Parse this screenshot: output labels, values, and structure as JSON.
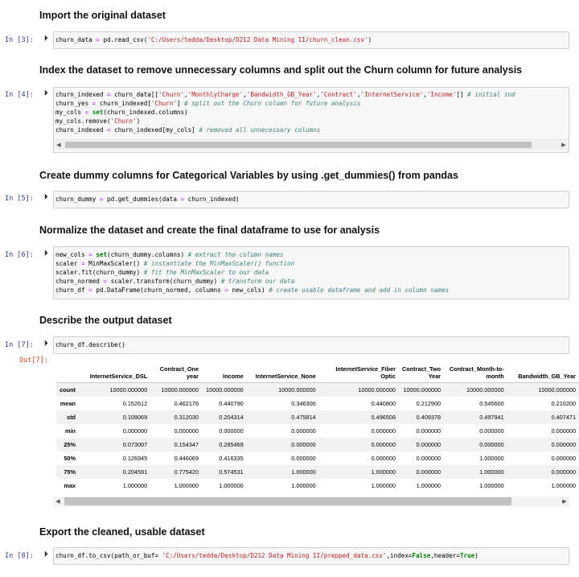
{
  "cells": [
    {
      "heading": "Import the original dataset",
      "prompt": "In [3]:"
    },
    {
      "heading": "Index the dataset to remove unnecessary columns and split out the Churn column for future analysis",
      "prompt": "In [4]:"
    },
    {
      "heading": "Create dummy columns for Categorical Variables by using .get_dummies() from pandas",
      "prompt": "In [5]:"
    },
    {
      "heading": "Normalize the dataset and create the final dataframe to use for analysis",
      "prompt": "In [6]:"
    },
    {
      "heading": "Describe the output dataset",
      "prompt": "In [7]:",
      "out_prompt": "Out[7]:"
    },
    {
      "heading": "Export the cleaned, usable dataset",
      "prompt": "In [8]:"
    }
  ],
  "run_icon": "step-forward-icon",
  "code": {
    "c3": "churn_data = pd.read_csv('C:/Users/tedda/Desktop/D212 Data Mining II/churn_clean.csv')",
    "c4": [
      "churn_indexed = churn_data[['Churn','MonthlyCharge','Bandwidth_GB_Year','Contract','InternetService','Income']] # initial ind",
      "churn_yes = churn_indexed['Churn'] # split out the Churn column for future analysis",
      "my_cols = set(churn_indexed.columns)",
      "my_cols.remove('Churn')",
      "churn_indexed = churn_indexed[my_cols] # removed all unnecessary columns"
    ],
    "c5": "churn_dummy = pd.get_dummies(data = churn_indexed)",
    "c6": [
      "new_cols = set(churn_dummy.columns) # extract the column names",
      "scaler = MinMaxScaler() # instantiate the MinMaxScaler() function",
      "scaler.fit(churn_dummy) # fit the MinMaxScaler to our data",
      "churn_normed = scaler.transform(churn_dummy) # transform our data",
      "churn_df = pd.DataFrame(churn_normed, columns = new_cols) # create usable dataframe and add in column names"
    ],
    "c7": "churn_df.describe()",
    "c8": "churn_df.to_csv(path_or_buf= 'C:/Users/tedda/Desktop/D212 Data Mining II/prepped_data.csv',index=False,header=True)"
  },
  "table": {
    "columns": [
      "InternetService_DSL",
      "Contract_One year",
      "Income",
      "InternetService_None",
      "InternetService_Fiber Optic",
      "Contract_Two Year",
      "Contract_Month-to-month",
      "Bandwidth_GB_Year"
    ],
    "rows": [
      {
        "label": "count",
        "values": [
          "10000.000000",
          "10000.000000",
          "10000.000000",
          "10000.000000",
          "10000.000000",
          "10000.000000",
          "10000.000000",
          "10000.000000"
        ]
      },
      {
        "label": "mean",
        "values": [
          "0.152612",
          "0.462176",
          "0.440790",
          "0.346300",
          "0.440800",
          "0.212900",
          "0.545600",
          "0.210200"
        ]
      },
      {
        "label": "std",
        "values": [
          "0.109069",
          "0.312030",
          "0.204314",
          "0.475814",
          "0.496508",
          "0.409378",
          "0.497941",
          "0.407471"
        ]
      },
      {
        "label": "min",
        "values": [
          "0.000000",
          "0.000000",
          "0.000000",
          "0.000000",
          "0.000000",
          "0.000000",
          "0.000000",
          "0.000000"
        ]
      },
      {
        "label": "25%",
        "values": [
          "0.073007",
          "0.154347",
          "0.285469",
          "0.000000",
          "0.000000",
          "0.000000",
          "0.000000",
          "0.000000"
        ]
      },
      {
        "label": "50%",
        "values": [
          "0.126945",
          "0.446069",
          "0.416335",
          "0.000000",
          "0.000000",
          "0.000000",
          "1.000000",
          "0.000000"
        ]
      },
      {
        "label": "75%",
        "values": [
          "0.204591",
          "0.775420",
          "0.574531",
          "1.000000",
          "1.000000",
          "0.000000",
          "1.000000",
          "0.000000"
        ]
      },
      {
        "label": "max",
        "values": [
          "1.000000",
          "1.000000",
          "1.000000",
          "1.000000",
          "1.000000",
          "1.000000",
          "1.000000",
          "1.000000"
        ]
      }
    ]
  }
}
